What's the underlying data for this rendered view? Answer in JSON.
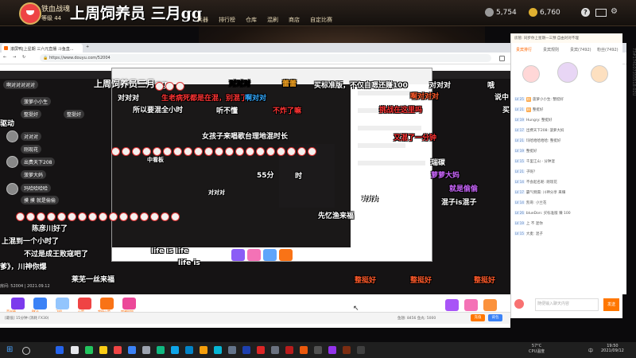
{
  "game": {
    "title": "铁血战魂",
    "level": "等级 44",
    "overlay_title": "上周饲养员 三月gg",
    "nav": [
      "兵器",
      "排行榜",
      "仓库",
      "混刷",
      "商店",
      "自定比赛"
    ],
    "coins": "5,754",
    "gold": "6,760",
    "help_icon": "?",
    "mail_icon": "mail-icon"
  },
  "browser": {
    "tab_title": "滚屏鸭|上星期 三六元直播 斗鱼直...",
    "url": "https://www.douyu.com/52004",
    "vertical_text": "73#174107355518:02U"
  },
  "stream": {
    "top_title": "上周饲养员三月gg",
    "danmaku": [
      {
        "text": "对对对",
        "color": "#ffffff"
      },
      {
        "text": "蕾蕾",
        "color": "#f0a020"
      },
      {
        "text": "买标准版，不仅自嗯还赚100",
        "color": "#ffffff"
      },
      {
        "text": "对对对",
        "color": "#ffffff"
      },
      {
        "text": "哦",
        "color": "#ffffff"
      },
      {
        "text": "啊对对对",
        "color": "#ff5a2a"
      },
      {
        "text": "说中",
        "color": "#ffffff"
      },
      {
        "text": "生老病死都是在混，别混了",
        "color": "#ff3333"
      },
      {
        "text": "啊对对",
        "color": "#33aaff"
      },
      {
        "text": "所以要混全小时",
        "color": "#ffffff"
      },
      {
        "text": "听不懂",
        "color": "#ffffff"
      },
      {
        "text": "不炸了嘛",
        "color": "#ff3333"
      },
      {
        "text": "挑战在这里吗",
        "color": "#ff3333"
      },
      {
        "text": "买",
        "color": "#ffffff"
      },
      {
        "text": "捡到一分钟",
        "color": "#ffffff"
      },
      {
        "text": "女孩子来唱歌台理地混时长",
        "color": "#ffffff"
      },
      {
        "text": "又混了一分钟",
        "color": "#ff3333"
      },
      {
        "text": "中看板",
        "color": "#ffffff"
      },
      {
        "text": "55分",
        "color": "#ffffff"
      },
      {
        "text": "时",
        "color": "#ffffff"
      },
      {
        "text": "驱动",
        "color": "#ffffff"
      },
      {
        "text": "瑞碳",
        "color": "#ffffff"
      },
      {
        "text": "萝萝大妈",
        "color": "#cc66ff"
      },
      {
        "text": "就是偷偷",
        "color": "#ffffff"
      },
      {
        "text": "猫狗",
        "color": "#ffffff"
      },
      {
        "text": "混子is混子",
        "color": "#ffffff"
      },
      {
        "text": "陈彦川好了",
        "color": "#ffffff"
      },
      {
        "text": "先忆渔来福",
        "color": "#ffffff"
      },
      {
        "text": "上混到一个小时了",
        "color": "#ffffff"
      },
      {
        "text": "不过是成王败寇吧了",
        "color": "#ffffff"
      },
      {
        "text": "爹》，川神你爆",
        "color": "#ffffff"
      },
      {
        "text": "莱芜一丝来福",
        "color": "#ffffff"
      },
      {
        "text": "整挺好",
        "color": "#ff5a2a"
      },
      {
        "text": "整挺好",
        "color": "#ff5a2a"
      },
      {
        "text": "整挺好",
        "color": "#ff5a2a"
      },
      {
        "text": "对对对",
        "color": "#ffffff"
      },
      {
        "text": "对对对",
        "color": "#ffffff"
      },
      {
        "text": "对对对",
        "color": "#ffffff"
      },
      {
        "text": "life is life",
        "color": "#ffffff"
      },
      {
        "text": "life is",
        "color": "#ffffff"
      }
    ],
    "chat_bubbles": [
      "啊对对对对对",
      "菠萝小小生",
      "整挺好",
      "整挺好",
      "对对对",
      "刚现花",
      "出费天下208",
      "菠萝大妈",
      "玛哈哈哈哈",
      "摸 摸 就是偷偷"
    ],
    "room_id": "房间: 52004 | 2021.09.12"
  },
  "right_panel": {
    "tabs": [
      "贵宾排行",
      "贵宾规则",
      "贵宾(7492)",
      "粉丝(7492)"
    ],
    "top_note": "房管: 同步你上星期一三预 自由对对不理",
    "chat": [
      {
        "lv": "LV 25",
        "user": "菠萝小小生",
        "text": "整挺好"
      },
      {
        "lv": "LV 21",
        "user": "",
        "text": "整挺好"
      },
      {
        "lv": "LV 19",
        "user": "Hungry",
        "text": "整挺好"
      },
      {
        "lv": "LV 17",
        "user": "出费天下208",
        "text": "菠萝大妈"
      },
      {
        "lv": "LV 21",
        "user": "玛哈哈哈哈哈",
        "text": "整挺好"
      },
      {
        "lv": "LV 19",
        "user": "",
        "text": "整挺好"
      },
      {
        "lv": "LV 15",
        "user": "",
        "text": "千里江山 - 分钟混"
      },
      {
        "lv": "LV 21",
        "user": "",
        "text": "子呢?"
      },
      {
        "lv": "LV 14",
        "user": "不会起名呢",
        "text": "刚现花"
      },
      {
        "lv": "LV 17",
        "user": "霸气侧漏",
        "text": "川神分享 来赚"
      },
      {
        "lv": "LV 14",
        "user": "凯哥",
        "text": "小兰花"
      },
      {
        "lv": "LV 26",
        "user": "blueDon",
        "text": "买标准版 赚 100"
      },
      {
        "lv": "LV 19",
        "user": "",
        "text": "上 不 混你"
      },
      {
        "lv": "LV 15",
        "user": "大麦",
        "text": "混子"
      }
    ],
    "input_placeholder": "随便输入聊天内容",
    "send_label": "发送"
  },
  "giftbar": {
    "labels": [
      "荧光棒",
      "PK卡",
      "飞机",
      "火箭",
      "超级火箭",
      "穿越时空"
    ],
    "bottom_left": "[最低] 15分钟 (消耗 FX30)",
    "bottom_mid": "鱼翅: 8456  鱼丸: 5000",
    "recharge": "充值",
    "backpack": "背包"
  },
  "taskbar": {
    "time": "19:50",
    "date": "2021/09/12",
    "cpu": "57°C",
    "cpu_label": "CPU温度",
    "lang": "中"
  }
}
